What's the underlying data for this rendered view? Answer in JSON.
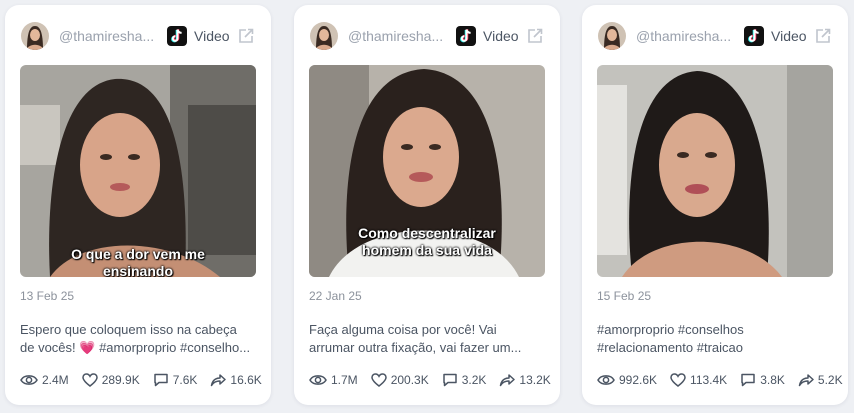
{
  "cards": [
    {
      "handle": "@thamiresha...",
      "post_type": "Video",
      "caption_overlay": [
        "O que a dor vem me",
        "ensinando"
      ],
      "date": "13 Feb 25",
      "description_lines": [
        "Espero que coloquem isso na cabeça",
        "de vocês! 💗 #amorproprio #conselho..."
      ],
      "stats": {
        "views": "2.4M",
        "likes": "289.9K",
        "comments": "7.6K",
        "shares": "16.6K"
      }
    },
    {
      "handle": "@thamiresha...",
      "post_type": "Video",
      "caption_overlay": [
        "Como descentralizar",
        "homem da sua vida"
      ],
      "date": "22 Jan 25",
      "description_lines": [
        "Faça alguma coisa por você! Vai",
        "arrumar outra fixação, vai fazer um..."
      ],
      "stats": {
        "views": "1.7M",
        "likes": "200.3K",
        "comments": "3.2K",
        "shares": "13.2K"
      }
    },
    {
      "handle": "@thamiresha...",
      "post_type": "Video",
      "caption_overlay": [],
      "date": "15 Feb 25",
      "description_lines": [
        "#amorproprio #conselhos",
        "#relacionamento #traicao"
      ],
      "stats": {
        "views": "992.6K",
        "likes": "113.4K",
        "comments": "3.8K",
        "shares": "5.2K"
      }
    }
  ],
  "icons": {
    "platform": "tiktok-icon",
    "external": "external-link-icon",
    "views": "eye-icon",
    "likes": "heart-icon",
    "comments": "comment-icon",
    "shares": "share-icon"
  },
  "colors": {
    "card_bg": "#ffffff",
    "page_bg": "#eef0f4",
    "text": "#4b5563",
    "muted": "#8c929c",
    "heart": "#ec4899"
  }
}
